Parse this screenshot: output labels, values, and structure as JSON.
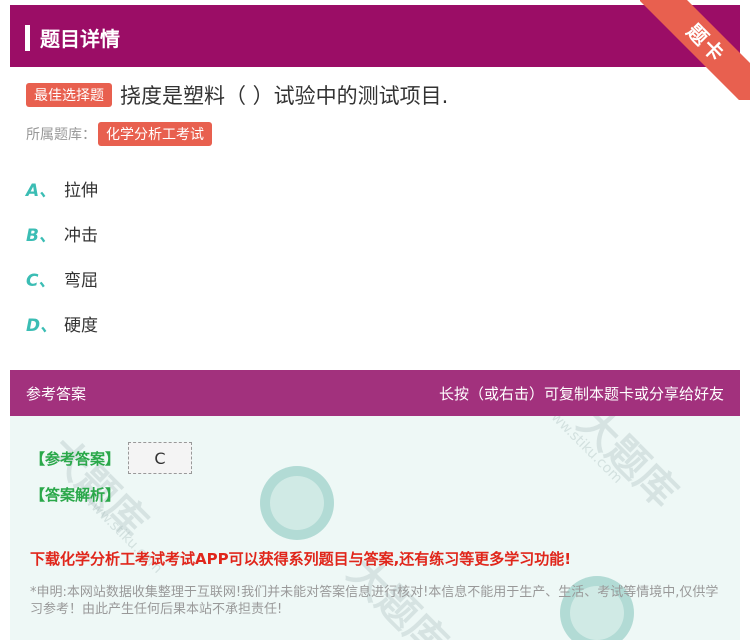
{
  "header": {
    "title": "题目详情",
    "ribbon": "题卡"
  },
  "question": {
    "type_tag": "最佳选择题",
    "text": "挠度是塑料（ ）试验中的测试项目.",
    "library_label": "所属题库：",
    "library_tag": "化学分析工考试"
  },
  "options": [
    {
      "letter": "A",
      "sep": "、",
      "text": "拉伸"
    },
    {
      "letter": "B",
      "sep": "、",
      "text": "冲击"
    },
    {
      "letter": "C",
      "sep": "、",
      "text": "弯屈"
    },
    {
      "letter": "D",
      "sep": "、",
      "text": "硬度"
    }
  ],
  "answer_section": {
    "left_label": "参考答案",
    "right_label": "长按（或右击）可复制本题卡或分享给好友",
    "ref_label": "【参考答案】",
    "ref_value": "C",
    "analysis_label": "【答案解析】",
    "download_text": "下载化学分析工考试考试APP可以获得系列题目与答案,还有练习等更多学习功能!",
    "disclaimer": "*申明:本网站数据收集整理于互联网!我们并未能对答案信息进行核对!本信息不能用于生产、生活、考试等情境中,仅供学习参考！由此产生任何后果本站不承担责任!"
  },
  "watermark": {
    "text": "大题库",
    "url": "www.stiku.com"
  },
  "colors": {
    "header": "#9b0d66",
    "accent_red": "#e8604f",
    "option_letter": "#3bbdb4",
    "answer_header": "#a2317d",
    "answer_bg": "#eef8f6"
  }
}
